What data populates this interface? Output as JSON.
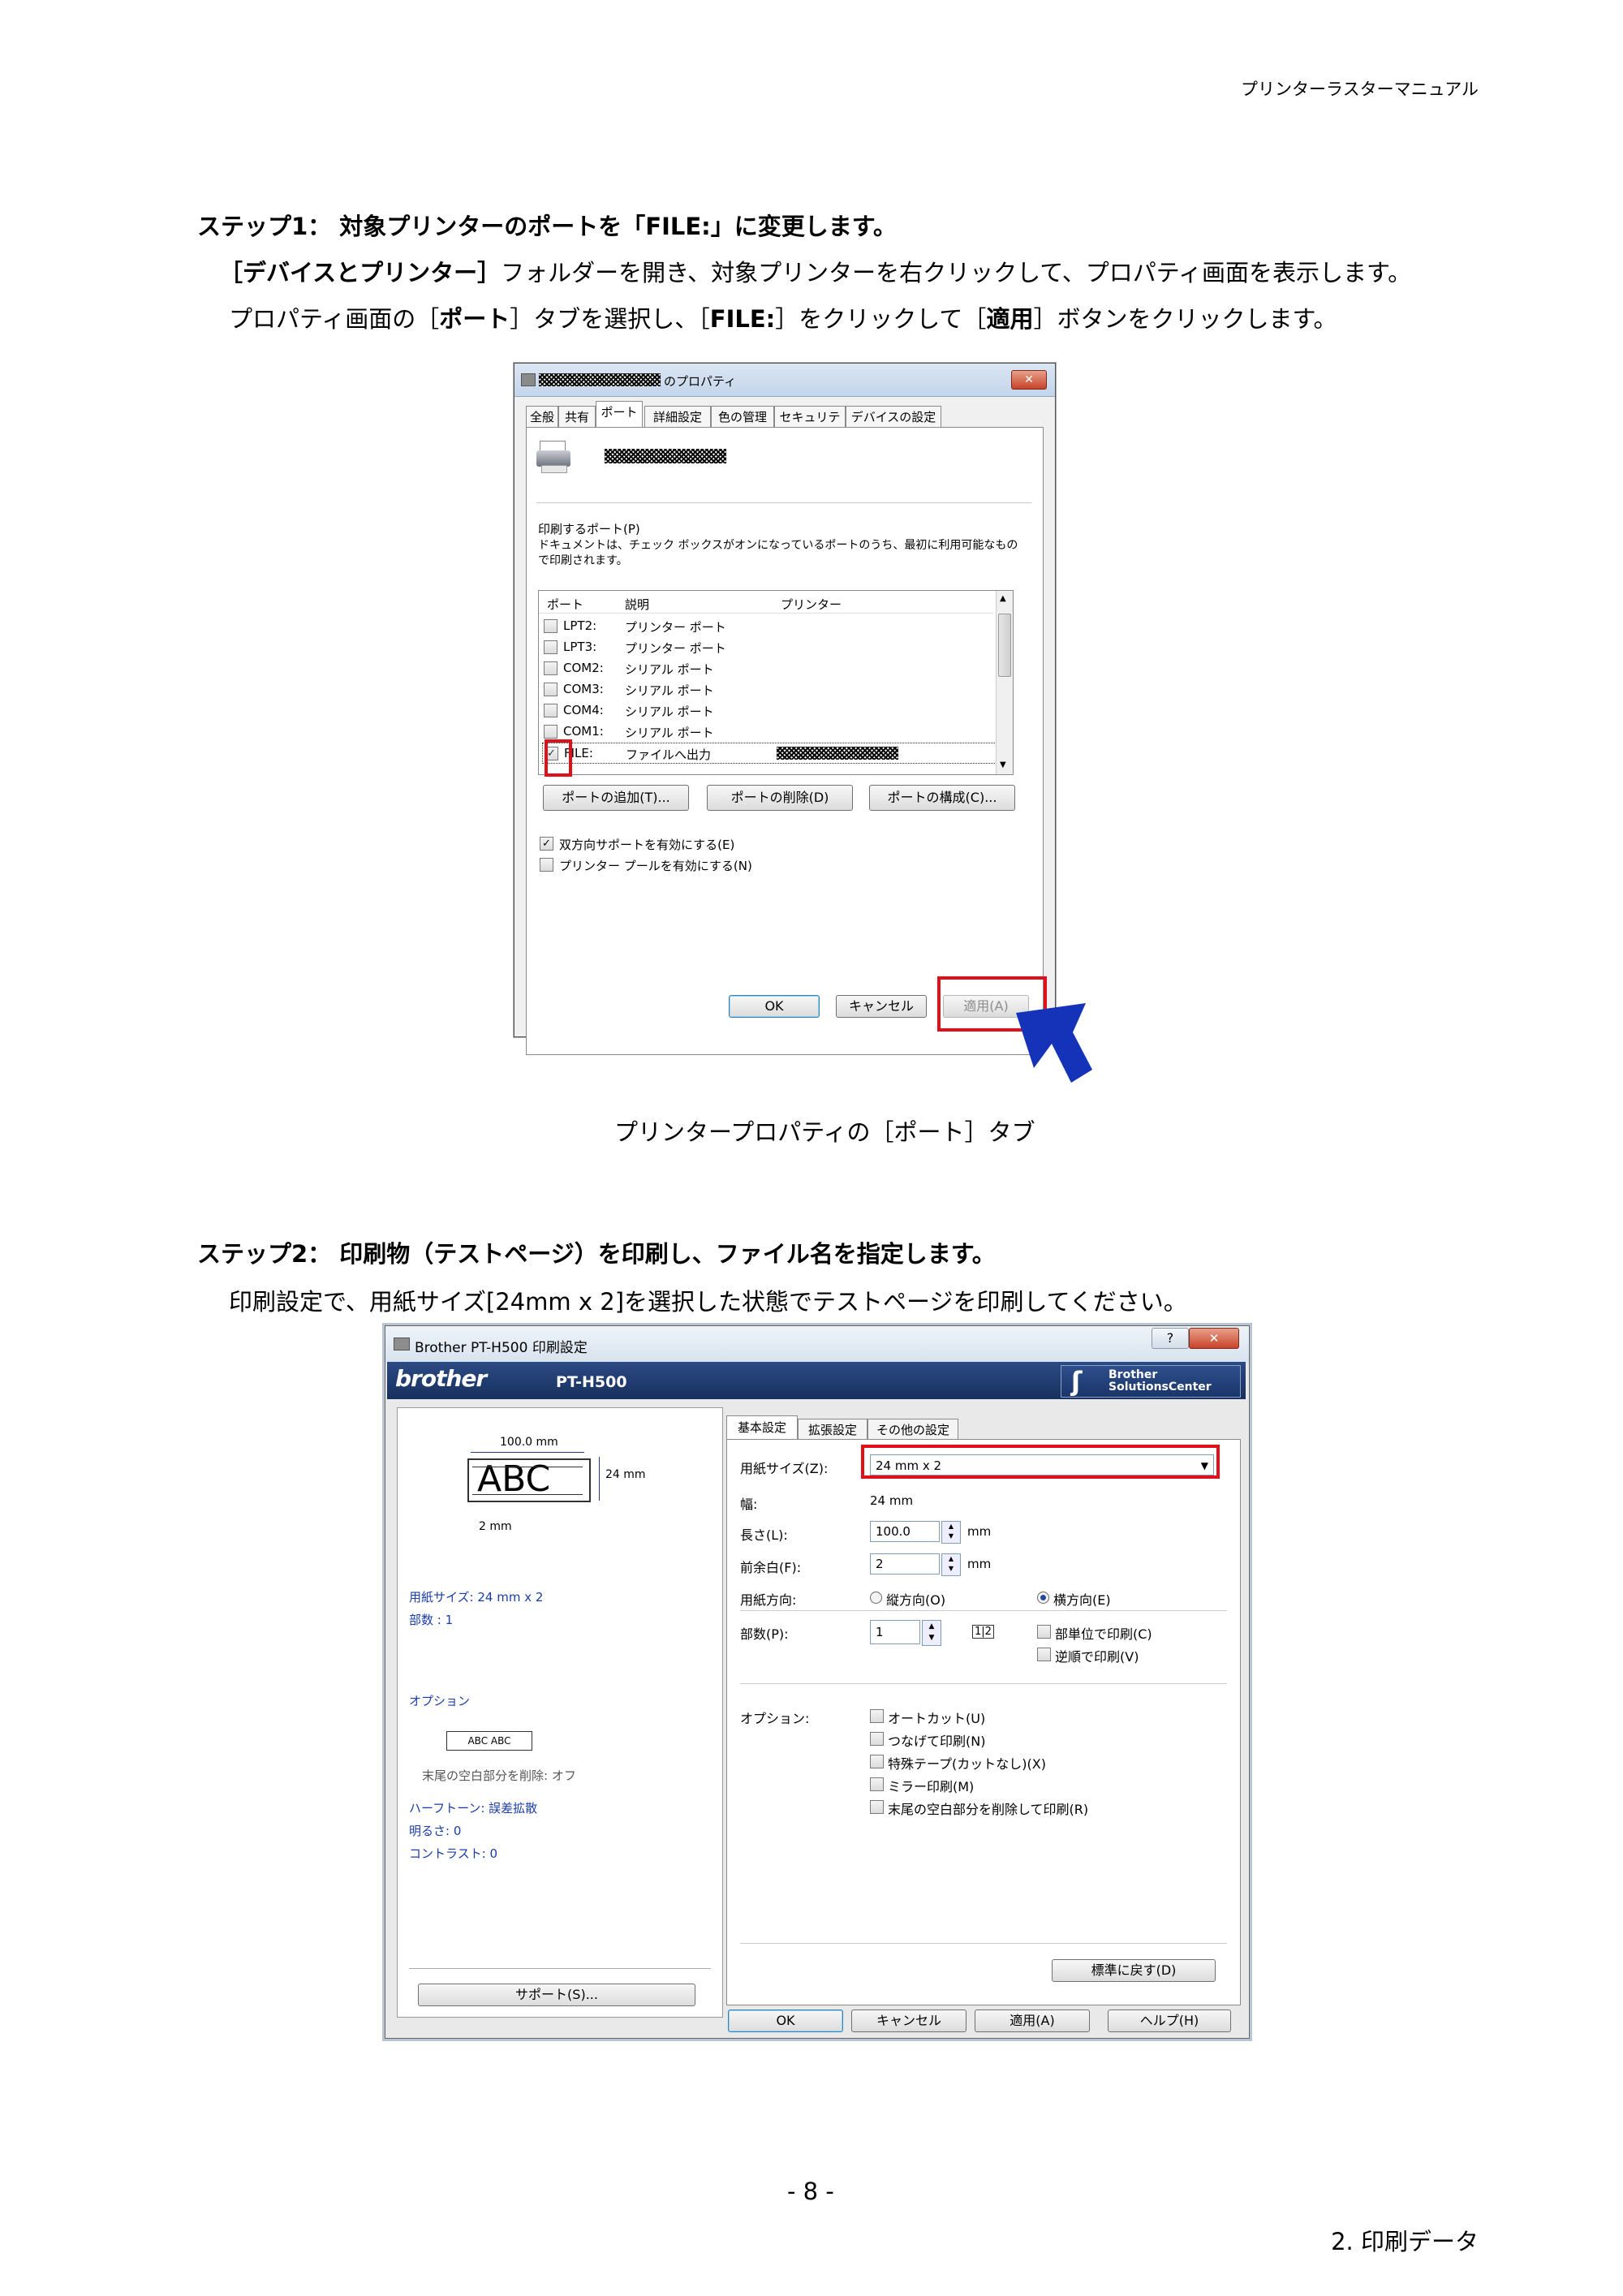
{
  "header": {
    "manual_title": "プリンターラスターマニュアル"
  },
  "step1": {
    "heading": "ステップ1：  対象プリンターのポートを「FILE:」に変更します。",
    "line1_bold": "［デバイスとプリンター］",
    "line1_rest": "フォルダーを開き、対象プリンターを右クリックして、プロパティ画面を表示します。",
    "line2_a": "プロパティ画面の［",
    "line2_b": "ポート",
    "line2_c": "］タブを選択し、［",
    "line2_d": "FILE:",
    "line2_e": "］をクリックして［",
    "line2_f": "適用",
    "line2_g": "］ボタンをクリックします。"
  },
  "dialog1": {
    "title_suffix": "のプロパティ",
    "tabs": [
      "全般",
      "共有",
      "ポート",
      "詳細設定",
      "色の管理",
      "セキュリティ",
      "デバイスの設定"
    ],
    "print_port_label": "印刷するポート(P)",
    "desc_line1": "ドキュメントは、チェック ボックスがオンになっているポートのうち、最初に利用可能なもの",
    "desc_line2": "で印刷されます。",
    "columns": [
      "ポート",
      "説明",
      "プリンター"
    ],
    "ports": [
      {
        "port": "LPT2:",
        "desc": "プリンター ポート"
      },
      {
        "port": "LPT3:",
        "desc": "プリンター ポート"
      },
      {
        "port": "COM2:",
        "desc": "シリアル ポート"
      },
      {
        "port": "COM3:",
        "desc": "シリアル ポート"
      },
      {
        "port": "COM4:",
        "desc": "シリアル ポート"
      },
      {
        "port": "COM1:",
        "desc": "シリアル ポート"
      },
      {
        "port": "FILE:",
        "desc": "ファイルへ出力"
      }
    ],
    "add_port": "ポートの追加(T)...",
    "delete_port": "ポートの削除(D)",
    "configure_port": "ポートの構成(C)...",
    "bidirectional": "双方向サポートを有効にする(E)",
    "pooling": "プリンター プールを有効にする(N)",
    "ok": "OK",
    "cancel": "キャンセル",
    "apply": "適用(A)",
    "close": "✕"
  },
  "caption1": "プリンタープロパティの［ポート］タブ",
  "step2": {
    "heading": "ステップ2：  印刷物（テストページ）を印刷し、ファイル名を指定します。",
    "line1": "印刷設定で、用紙サイズ[24mm x 2]を選択した状態でテストページを印刷してください。"
  },
  "dialog2": {
    "title": "Brother PT-H500 印刷設定",
    "brand": "brother",
    "model": "PT-H500",
    "solutions_1": "Brother",
    "solutions_2": "SolutionsCenter",
    "help_btn": "?",
    "close_btn": "✕",
    "preview_width": "100.0 mm",
    "preview_height": "24 mm",
    "preview_margin": "2 mm",
    "preview_text": "ABC",
    "summary_size": "用紙サイズ: 24 mm x 2",
    "summary_copies": "部数 : 1",
    "summary_option": "オプション",
    "summary_abc": "ABC ABC",
    "summary_trim": "末尾の空白部分を削除: オフ",
    "summary_halftone": "ハーフトーン: 誤差拡散",
    "summary_brightness": "明るさ:   0",
    "summary_contrast": "コントラスト:   0",
    "support_btn": "サポート(S)...",
    "tabs": [
      "基本設定",
      "拡張設定",
      "その他の設定"
    ],
    "paper_size_label": "用紙サイズ(Z):",
    "paper_size_value": "24 mm x 2",
    "width_label": "幅:",
    "width_value": "24 mm",
    "length_label": "長さ(L):",
    "length_value": "100.0",
    "margin_label": "前余白(F):",
    "margin_value": "2",
    "unit_mm": "mm",
    "orientation_label": "用紙方向:",
    "portrait": "縦方向(O)",
    "landscape": "横方向(E)",
    "copies_label": "部数(P):",
    "copies_value": "1",
    "collate": "部単位で印刷(C)",
    "reverse": "逆順で印刷(V)",
    "options_label": "オプション:",
    "options": [
      "オートカット(U)",
      "つなげて印刷(N)",
      "特殊テープ(カットなし)(X)",
      "ミラー印刷(M)",
      "末尾の空白部分を削除して印刷(R)"
    ],
    "defaults_btn": "標準に戻す(D)",
    "ok": "OK",
    "cancel": "キャンセル",
    "apply": "適用(A)",
    "help": "ヘルプ(H)"
  },
  "footer": {
    "page": "- 8 -",
    "section": "2. 印刷データ"
  }
}
